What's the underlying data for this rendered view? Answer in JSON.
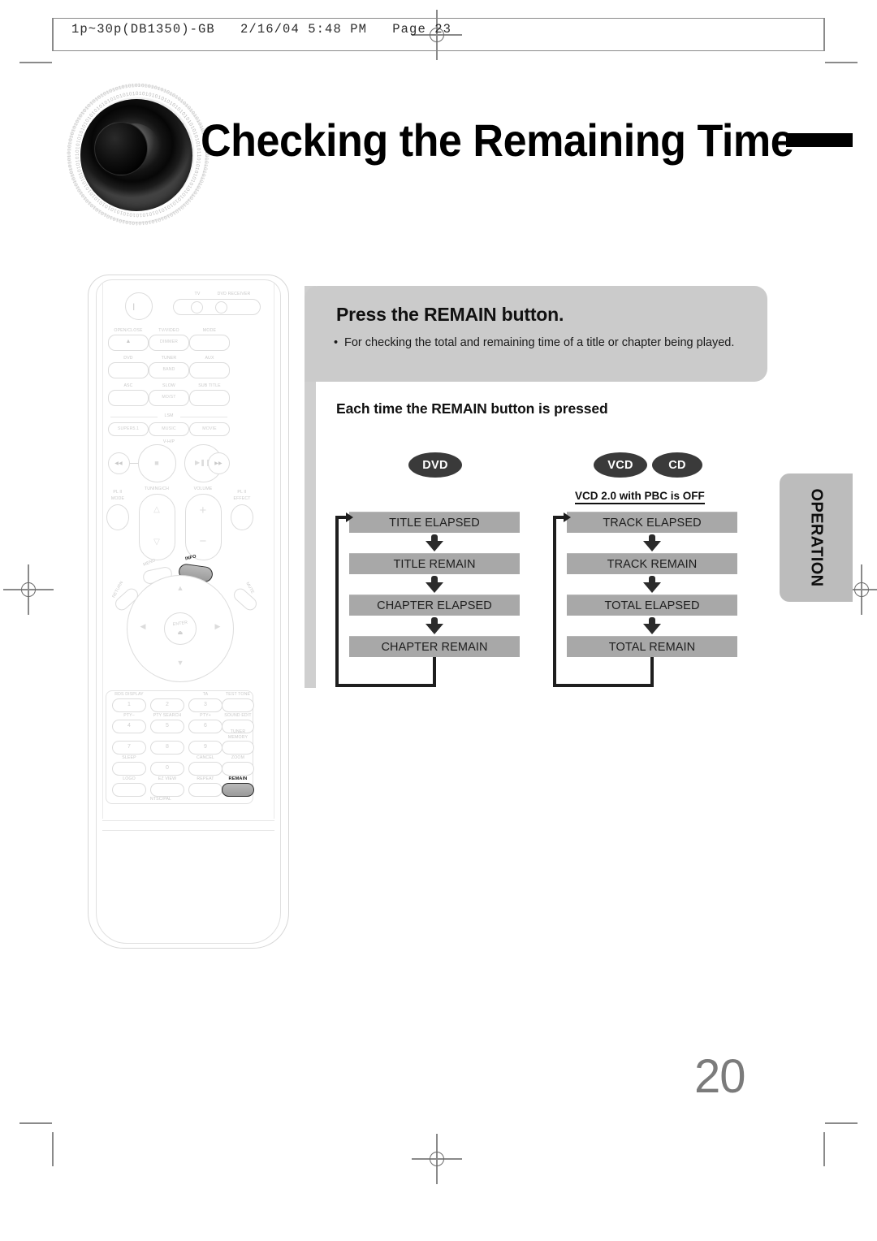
{
  "print_header": {
    "text": "1p~30p(DB1350)-GB   2/16/04 5:48 PM   Page 23"
  },
  "title": {
    "text": "Checking the Remaining Time",
    "disc_ring_text": "01010101010101010101010101010101010101"
  },
  "callout": {
    "heading": "Press the REMAIN button.",
    "bullet_marker": "•",
    "bullet_text": "For checking the total and remaining time of a title or chapter being played."
  },
  "section": {
    "heading": "Each time the REMAIN button is pressed"
  },
  "badges": {
    "dvd": "DVD",
    "vcd": "VCD",
    "cd": "CD"
  },
  "pbc_note": "VCD 2.0 with PBC is OFF",
  "flow_dvd": {
    "steps": [
      "TITLE ELAPSED",
      "TITLE REMAIN",
      "CHAPTER ELAPSED",
      "CHAPTER REMAIN"
    ]
  },
  "flow_vcd_cd": {
    "steps": [
      "TRACK ELAPSED",
      "TRACK REMAIN",
      "TOTAL ELAPSED",
      "TOTAL REMAIN"
    ]
  },
  "side_tab": {
    "label": "OPERATION"
  },
  "page_number": "20",
  "remote": {
    "top_labels": {
      "tv": "TV",
      "dvd_receiver": "DVD RECEIVER"
    },
    "row1": [
      "OPEN/CLOSE",
      "TV/VIDEO",
      "MODE"
    ],
    "row1_inner": [
      "DIMMER"
    ],
    "row2": [
      "DVD",
      "TUNER",
      "AUX"
    ],
    "row2_inner": [
      "BAND"
    ],
    "row3": [
      "ASC",
      "SLOW",
      "SUB TITLE"
    ],
    "row3_inner": [
      "MO/ST"
    ],
    "lsm_divider": "LSM",
    "lsm_buttons": [
      "SUPER5.1",
      "MUSIC",
      "MOVIE"
    ],
    "vhp_label": "V-H/P",
    "transport": {
      "prev": "◀◀",
      "stop": "■",
      "play_pause": "▶❘❘",
      "next": "▶▶"
    },
    "tuning_label": "TUNING/CH",
    "volume_label": "VOLUME",
    "pl_mode": [
      "PL II",
      "MODE"
    ],
    "pl_effect": [
      "PL II",
      "EFFECT"
    ],
    "menu_label": "MENU",
    "info_label": "INFO",
    "return_label": "RETURN",
    "mute_label": "MUTE",
    "enter_label": "ENTER",
    "keypad_rows": [
      {
        "labels": [
          "RDS DISPLAY",
          "",
          "TA",
          "TEST TONE"
        ],
        "numbers": [
          "1",
          "2",
          "3",
          ""
        ]
      },
      {
        "labels": [
          "PTY–",
          "PTY SEARCH",
          "PTY+",
          "SOUND EDIT"
        ],
        "numbers": [
          "4",
          "5",
          "6",
          ""
        ]
      },
      {
        "labels": [
          "",
          "",
          "",
          "TUNER MEMORY"
        ],
        "numbers": [
          "7",
          "8",
          "9",
          ""
        ]
      },
      {
        "labels": [
          "SLEEP",
          "",
          "CANCEL",
          "ZOOM"
        ],
        "numbers": [
          "",
          "0",
          "",
          ""
        ]
      },
      {
        "labels": [
          "LOGO",
          "EZ VIEW",
          "REPEAT",
          "REMAIN"
        ],
        "numbers": [
          "",
          "",
          "",
          ""
        ]
      }
    ],
    "ntsc_pal": "NTSC/PAL",
    "highlighted_buttons": [
      "INFO",
      "REMAIN"
    ]
  }
}
